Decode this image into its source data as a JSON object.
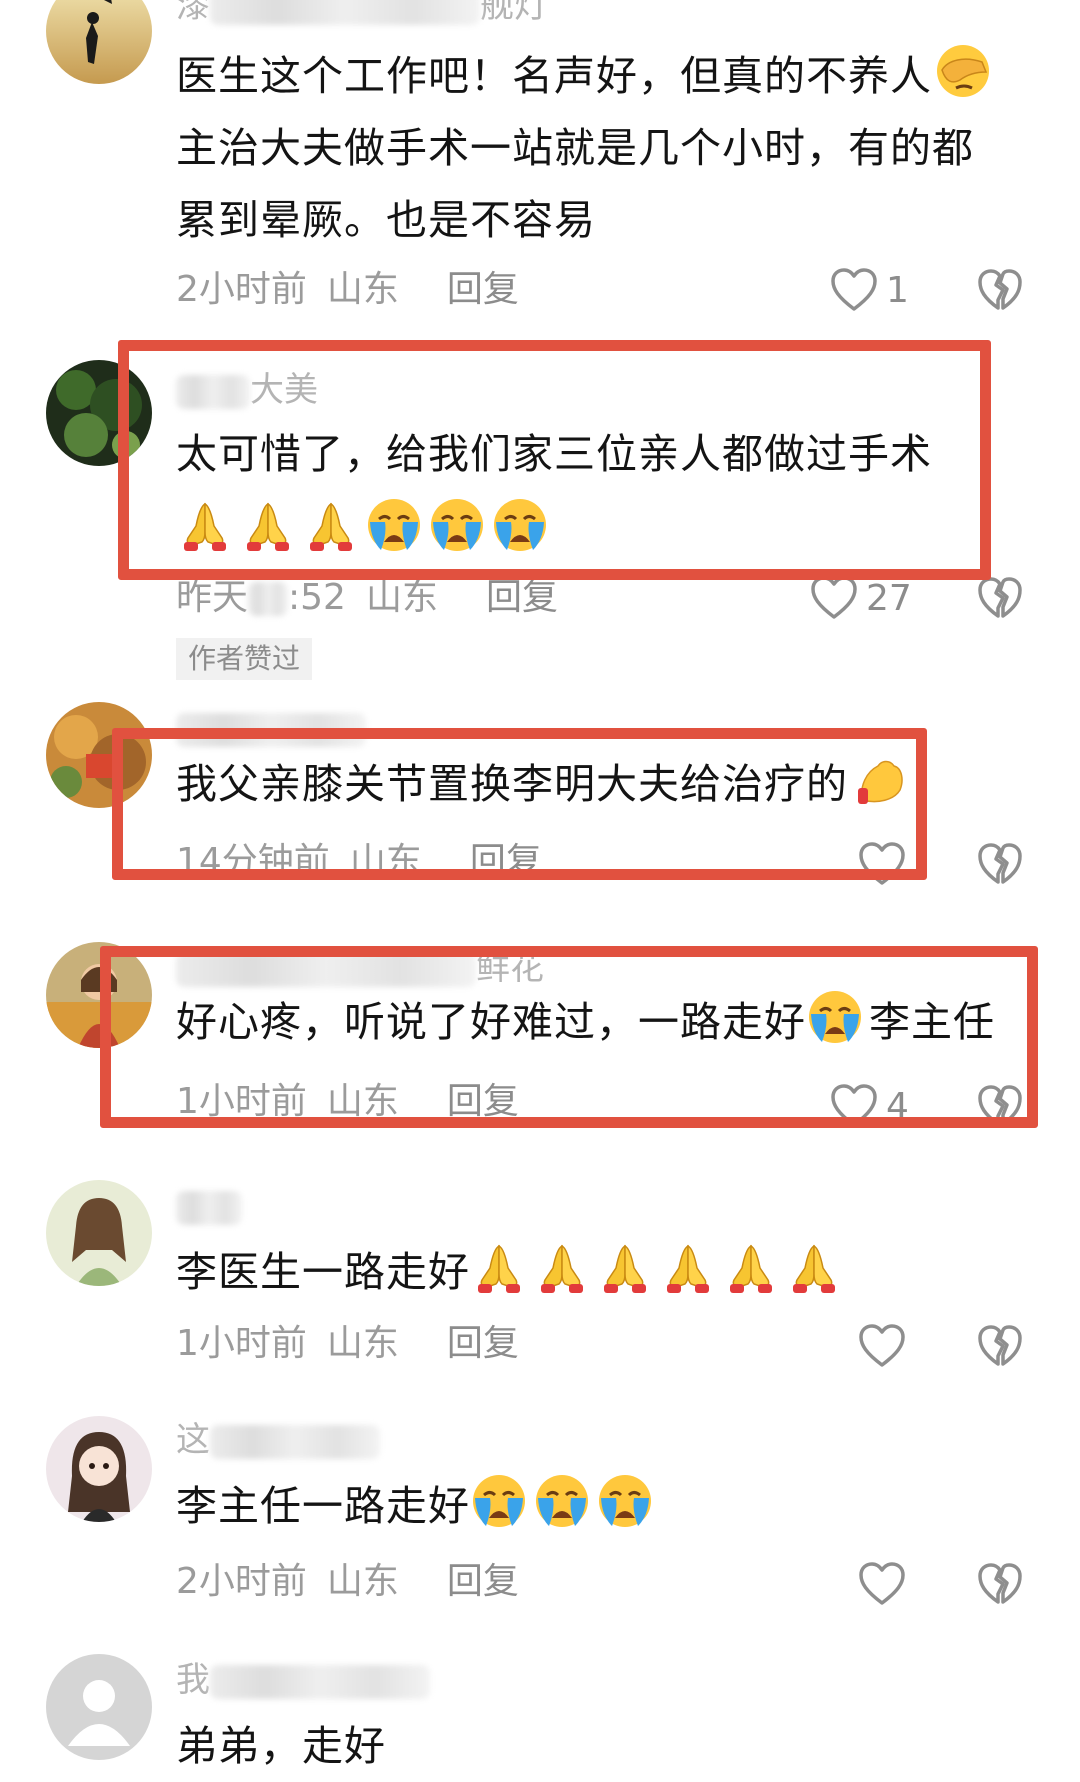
{
  "comments": [
    {
      "username_visible": "漆",
      "username_suffix": "舰灯",
      "lines": [
        "医生这个工作吧！名声好，但真的不养人",
        "主治大夫做手术一站就是几个小时，有的都",
        "累到晕厥。也是不容易"
      ],
      "time": "2小时前",
      "location": "山东",
      "reply_label": "回复",
      "likes": "1",
      "emoji": "facepalm"
    },
    {
      "username_visible": "",
      "username_suffix": "大美",
      "lines": [
        "太可惜了，给我们家三位亲人都做过手术"
      ],
      "emoji_line": [
        "folded-hands",
        "folded-hands",
        "folded-hands",
        "loudly-crying",
        "loudly-crying",
        "loudly-crying"
      ],
      "time": "昨天",
      "time_suffix": ":52",
      "location": "山东",
      "reply_label": "回复",
      "likes": "27",
      "badge": "作者赞过"
    },
    {
      "username_visible": "",
      "lines": [
        "我父亲膝关节置换李明大夫给治疗的"
      ],
      "emoji": "flexed-biceps",
      "time": "14分钟前",
      "location": "山东",
      "reply_label": "回复",
      "likes": ""
    },
    {
      "username_visible": "",
      "username_suffix": "鲜花",
      "lines": [
        "好心疼，听说了好难过，一路走好",
        "李主任"
      ],
      "emoji": "loudly-crying",
      "time": "1小时前",
      "location": "山东",
      "reply_label": "回复",
      "likes": "4"
    },
    {
      "username_visible": "",
      "lines": [
        "李医生一路走好"
      ],
      "emoji_line": [
        "folded-hands",
        "folded-hands",
        "folded-hands",
        "folded-hands",
        "folded-hands",
        "folded-hands"
      ],
      "time": "1小时前",
      "location": "山东",
      "reply_label": "回复",
      "likes": ""
    },
    {
      "username_visible": "这",
      "lines": [
        "李主任一路走好"
      ],
      "emoji_line": [
        "loudly-crying",
        "loudly-crying",
        "loudly-crying"
      ],
      "time": "2小时前",
      "location": "山东",
      "reply_label": "回复",
      "likes": ""
    },
    {
      "username_visible": "我",
      "lines": [
        "弟弟，走好"
      ]
    }
  ],
  "colors": {
    "highlight_border": "#e1513f",
    "meta_text": "#9b9b9b",
    "comment_text": "#141414"
  },
  "icons": {
    "like": "heart-outline-icon",
    "dislike": "broken-heart-icon"
  }
}
